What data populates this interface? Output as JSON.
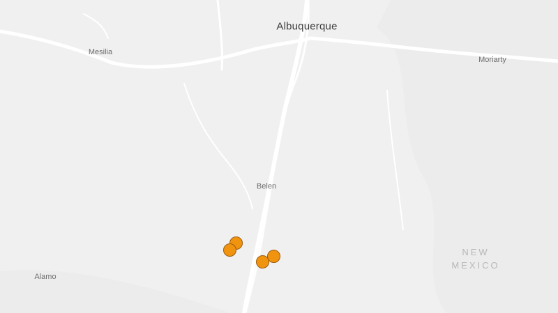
{
  "map": {
    "places": {
      "albuquerque": "Albuquerque",
      "moriarty": "Moriarty",
      "meselia": "Mesilia",
      "belen": "Belen",
      "alamo": "Alamo"
    },
    "state_label": {
      "line1": "NEW",
      "line2": "MEXICO"
    },
    "markers": {
      "count": 4,
      "color": "#f0940f",
      "stroke": "#9a5a0c"
    },
    "style": {
      "background": "#f0f0f0",
      "water": "#ffffff",
      "roads": "#ffffff",
      "label_color": "#6d6d6d"
    }
  }
}
